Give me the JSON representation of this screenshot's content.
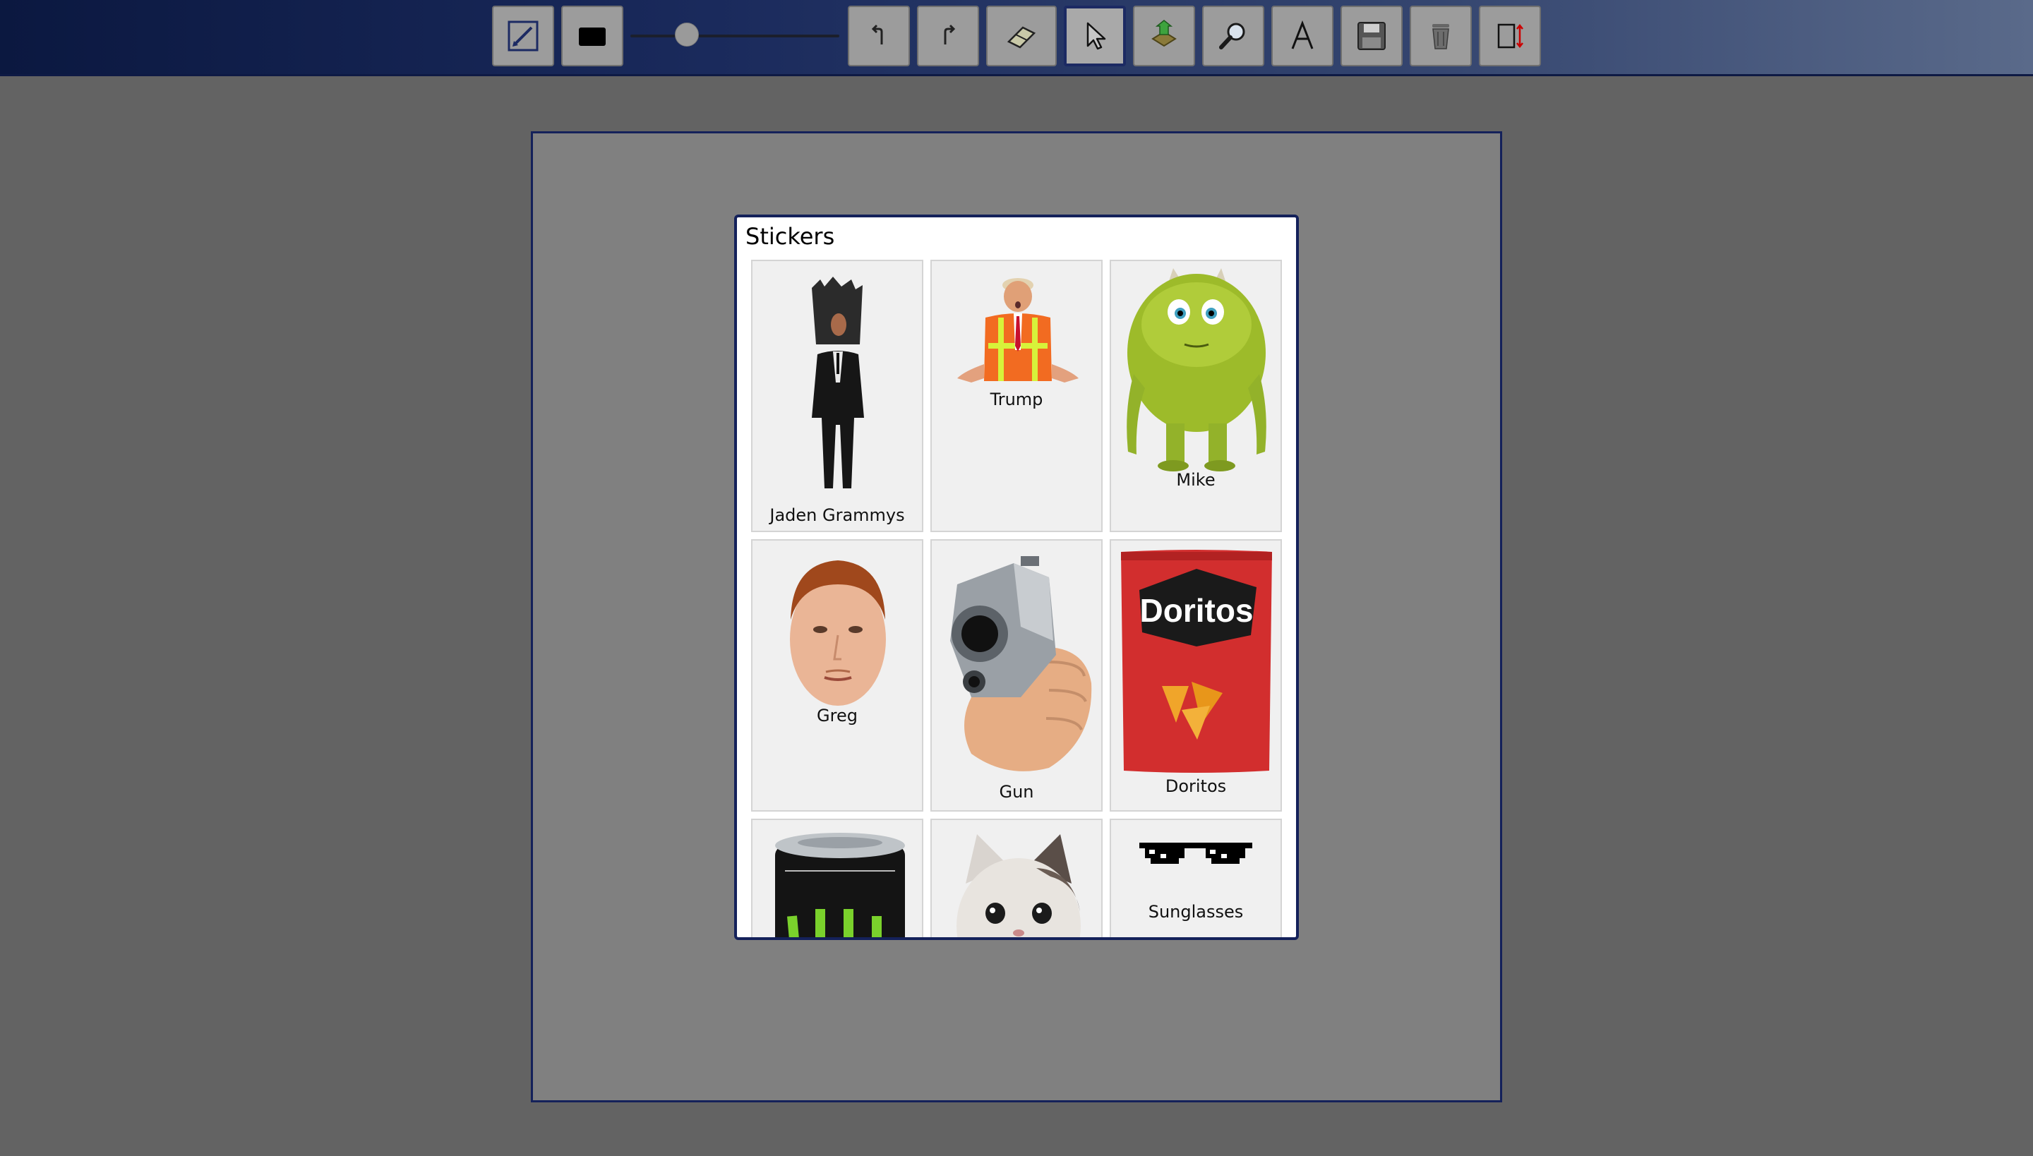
{
  "toolbar": {
    "tools": [
      {
        "id": "pencil",
        "icon": "pencil-icon"
      },
      {
        "id": "color",
        "icon": "color-swatch-icon",
        "color": "#000000"
      },
      {
        "id": "undo",
        "icon": "undo-icon"
      },
      {
        "id": "redo",
        "icon": "redo-icon"
      },
      {
        "id": "eraser",
        "icon": "eraser-icon"
      },
      {
        "id": "select",
        "icon": "pointer-icon",
        "active": true
      },
      {
        "id": "sticker",
        "icon": "sticker-icon"
      },
      {
        "id": "zoom",
        "icon": "magnifier-icon"
      },
      {
        "id": "text",
        "icon": "text-icon",
        "glyph": "A"
      },
      {
        "id": "save",
        "icon": "floppy-disk-icon"
      },
      {
        "id": "clear",
        "icon": "trash-icon"
      },
      {
        "id": "resize",
        "icon": "resize-icon"
      }
    ],
    "brush_size_fraction": 0.27
  },
  "dialog": {
    "title": "Stickers",
    "stickers": [
      {
        "label": "Jaden Grammys"
      },
      {
        "label": "Trump"
      },
      {
        "label": "Mike"
      },
      {
        "label": "Greg"
      },
      {
        "label": "Gun"
      },
      {
        "label": "Doritos",
        "image_text": "Doritos"
      },
      {
        "label": ""
      },
      {
        "label": ""
      },
      {
        "label": "Sunglasses"
      }
    ]
  },
  "colors": {
    "accent_border": "#14215a",
    "canvas": "#808080",
    "workspace": "#636363"
  }
}
